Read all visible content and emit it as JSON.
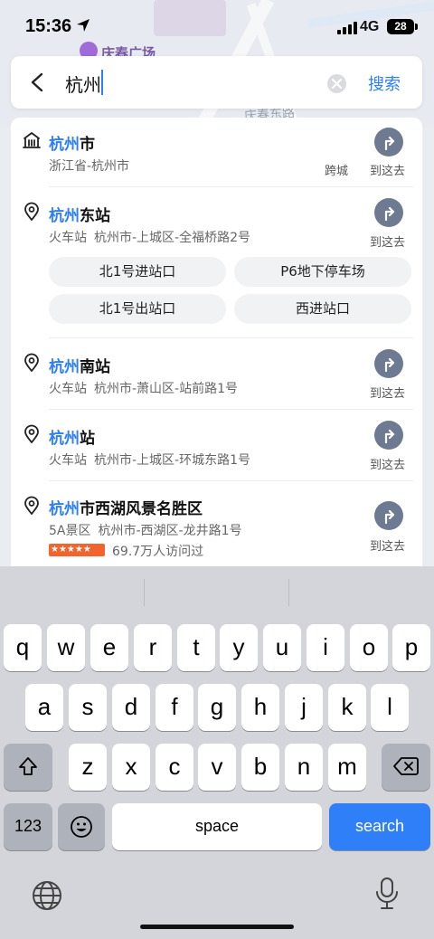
{
  "status_bar": {
    "time": "15:36",
    "network": "4G",
    "battery": "28"
  },
  "map": {
    "poi_label": "庆春广场",
    "street_label": "庆春东路"
  },
  "search": {
    "query": "杭州",
    "submit_label": "搜索"
  },
  "results": [
    {
      "icon": "city-icon",
      "name_highlight": "杭州",
      "name_rest": "市",
      "address": "浙江省-杭州市",
      "tag": "跨城",
      "action": "到这去"
    },
    {
      "icon": "location-pin-icon",
      "name_highlight": "杭州",
      "name_rest": "东站",
      "category": "火车站",
      "address": "杭州市-上城区-全福桥路2号",
      "action": "到这去",
      "sub_entrances": [
        "北1号进站口",
        "P6地下停车场",
        "北1号出站口",
        "西进站口"
      ]
    },
    {
      "icon": "location-pin-icon",
      "name_highlight": "杭州",
      "name_rest": "南站",
      "category": "火车站",
      "address": "杭州市-萧山区-站前路1号",
      "action": "到这去"
    },
    {
      "icon": "location-pin-icon",
      "name_highlight": "杭州",
      "name_rest": "站",
      "category": "火车站",
      "address": "杭州市-上城区-环城东路1号",
      "action": "到这去"
    },
    {
      "icon": "location-pin-icon",
      "name_highlight": "杭州",
      "name_rest": "市西湖风景名胜区",
      "category": "5A景区",
      "address": "杭州市-西湖区-龙井路1号",
      "rating_stars": 4.5,
      "visits": "69.7万人访问过",
      "action": "到这去"
    }
  ],
  "keyboard": {
    "row1": [
      "q",
      "w",
      "e",
      "r",
      "t",
      "y",
      "u",
      "i",
      "o",
      "p"
    ],
    "row2": [
      "a",
      "s",
      "d",
      "f",
      "g",
      "h",
      "j",
      "k",
      "l"
    ],
    "row3": [
      "z",
      "x",
      "c",
      "v",
      "b",
      "n",
      "m"
    ],
    "numbers_label": "123",
    "space_label": "space",
    "search_label": "search"
  },
  "colors": {
    "accent": "#2d7ff9",
    "go_button": "#6e7a91",
    "rating": "#f2642d"
  }
}
